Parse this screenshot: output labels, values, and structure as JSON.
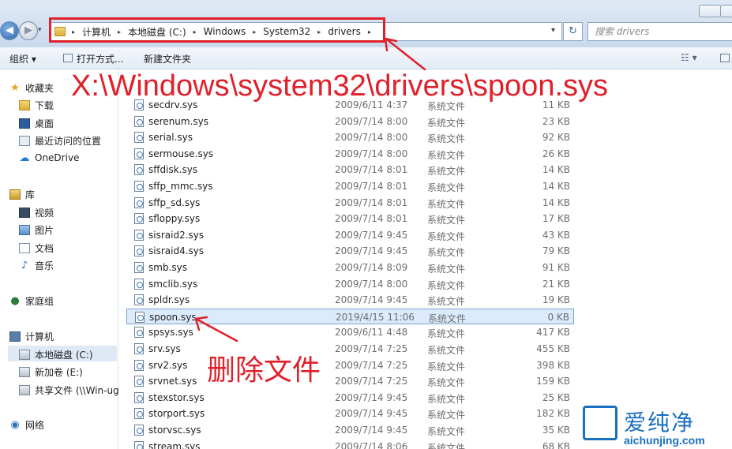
{
  "window": {
    "min_label": "",
    "max_label": ""
  },
  "nav": {
    "back_glyph": "◀",
    "forward_glyph": "▶",
    "history_glyph": "▾"
  },
  "address": {
    "crumbs": [
      "计算机",
      "本地磁盘 (C:)",
      "Windows",
      "System32",
      "drivers"
    ],
    "separator": "▸",
    "dropdown_glyph": "▾",
    "refresh_glyph": "↻"
  },
  "search": {
    "placeholder": "搜索 drivers"
  },
  "toolbar": {
    "organize": "组织 ▾",
    "open_with": "打开方式...",
    "new_folder": "新建文件夹",
    "view_glyph": "☷ ▾"
  },
  "sidebar": {
    "favorites": "收藏夹",
    "downloads": "下载",
    "desktop": "桌面",
    "recent": "最近访问的位置",
    "onedrive": "OneDrive",
    "library": "库",
    "videos": "视频",
    "pictures": "图片",
    "documents": "文档",
    "music": "音乐",
    "homegroup": "家庭组",
    "computer": "计算机",
    "drive_c": "本地磁盘 (C:)",
    "drive_e": "新加卷 (E:)",
    "share": "共享文件 (\\\\Win-ug",
    "network": "网络"
  },
  "files": [
    {
      "name": "secdrv.sys",
      "date": "2009/6/11 4:37",
      "type": "系统文件",
      "size": "11 KB"
    },
    {
      "name": "serenum.sys",
      "date": "2009/7/14 8:00",
      "type": "系统文件",
      "size": "23 KB"
    },
    {
      "name": "serial.sys",
      "date": "2009/7/14 8:00",
      "type": "系统文件",
      "size": "92 KB"
    },
    {
      "name": "sermouse.sys",
      "date": "2009/7/14 8:00",
      "type": "系统文件",
      "size": "26 KB"
    },
    {
      "name": "sffdisk.sys",
      "date": "2009/7/14 8:01",
      "type": "系统文件",
      "size": "14 KB"
    },
    {
      "name": "sffp_mmc.sys",
      "date": "2009/7/14 8:01",
      "type": "系统文件",
      "size": "14 KB"
    },
    {
      "name": "sffp_sd.sys",
      "date": "2009/7/14 8:01",
      "type": "系统文件",
      "size": "14 KB"
    },
    {
      "name": "sfloppy.sys",
      "date": "2009/7/14 8:01",
      "type": "系统文件",
      "size": "17 KB"
    },
    {
      "name": "sisraid2.sys",
      "date": "2009/7/14 9:45",
      "type": "系统文件",
      "size": "43 KB"
    },
    {
      "name": "sisraid4.sys",
      "date": "2009/7/14 9:45",
      "type": "系统文件",
      "size": "79 KB"
    },
    {
      "name": "smb.sys",
      "date": "2009/7/14 8:09",
      "type": "系统文件",
      "size": "91 KB"
    },
    {
      "name": "smclib.sys",
      "date": "2009/7/14 8:00",
      "type": "系统文件",
      "size": "21 KB"
    },
    {
      "name": "spldr.sys",
      "date": "2009/7/14 9:45",
      "type": "系统文件",
      "size": "19 KB"
    },
    {
      "name": "spoon.sys",
      "date": "2019/4/15 11:06",
      "type": "系统文件",
      "size": "0 KB"
    },
    {
      "name": "spsys.sys",
      "date": "2009/6/11 4:48",
      "type": "系统文件",
      "size": "417 KB"
    },
    {
      "name": "srv.sys",
      "date": "2009/7/14 7:25",
      "type": "系统文件",
      "size": "455 KB"
    },
    {
      "name": "srv2.sys",
      "date": "2009/7/14 7:25",
      "type": "系统文件",
      "size": "398 KB"
    },
    {
      "name": "srvnet.sys",
      "date": "2009/7/14 7:25",
      "type": "系统文件",
      "size": "159 KB"
    },
    {
      "name": "stexstor.sys",
      "date": "2009/7/14 9:45",
      "type": "系统文件",
      "size": "25 KB"
    },
    {
      "name": "storport.sys",
      "date": "2009/7/14 9:45",
      "type": "系统文件",
      "size": "182 KB"
    },
    {
      "name": "storvsc.sys",
      "date": "2009/7/14 9:45",
      "type": "系统文件",
      "size": "35 KB"
    },
    {
      "name": "stream.sys",
      "date": "2009/7/14 8:06",
      "type": "系统文件",
      "size": "68 KB"
    }
  ],
  "selected_file": "spoon.sys",
  "annotations": {
    "path": "X:\\Windows\\system32\\drivers\\spoon.sys",
    "delete_note": "删除文件",
    "color": "#e0202a"
  },
  "watermark": {
    "brand": "爱纯净",
    "site": "aichunjing.com",
    "color": "#1a6fbf"
  }
}
